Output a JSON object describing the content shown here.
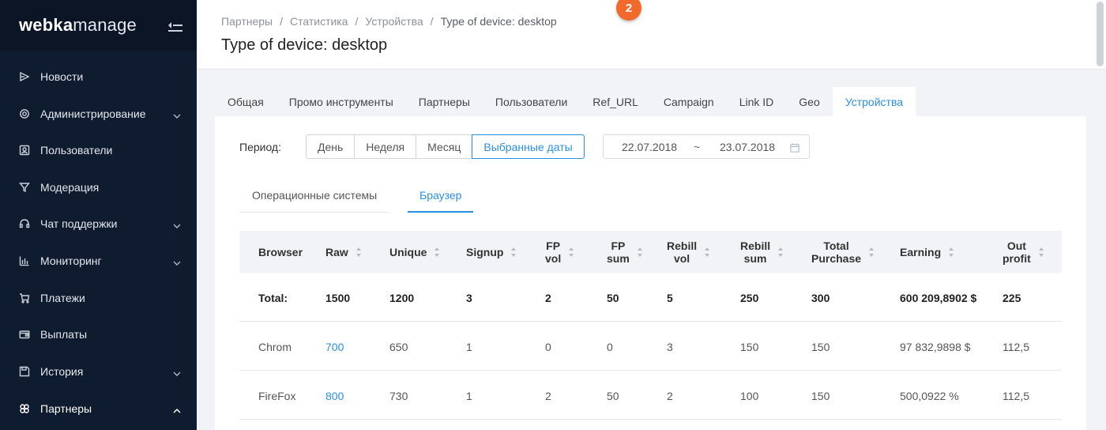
{
  "brand": {
    "logo_bold": "webka",
    "logo_regular": "manage"
  },
  "sidebar": {
    "items": [
      {
        "label": "Новости",
        "icon": "news-icon",
        "has_children": false
      },
      {
        "label": "Администрирование",
        "icon": "gear-icon",
        "has_children": true
      },
      {
        "label": "Пользователи",
        "icon": "users-icon",
        "has_children": false
      },
      {
        "label": "Модерация",
        "icon": "filter-icon",
        "has_children": false
      },
      {
        "label": "Чат поддержки",
        "icon": "headset-icon",
        "has_children": true
      },
      {
        "label": "Мониторинг",
        "icon": "bar-chart-icon",
        "has_children": true
      },
      {
        "label": "Платежи",
        "icon": "cart-icon",
        "has_children": false
      },
      {
        "label": "Выплаты",
        "icon": "wallet-icon",
        "has_children": false
      },
      {
        "label": "История",
        "icon": "save-icon",
        "has_children": true
      },
      {
        "label": "Партнеры",
        "icon": "partners-icon",
        "has_children": true,
        "expanded": true,
        "active": true
      }
    ]
  },
  "header": {
    "breadcrumb": [
      "Партнеры",
      "Статистика",
      "Устройства"
    ],
    "breadcrumb_current": "Type of device: desktop",
    "title": "Type of device: desktop",
    "badge": "2",
    "badge_color": "#f26a2b"
  },
  "tabs": [
    {
      "label": "Общая"
    },
    {
      "label": "Промо инструменты"
    },
    {
      "label": "Партнеры"
    },
    {
      "label": "Пользователи"
    },
    {
      "label": "Ref_URL"
    },
    {
      "label": "Campaign"
    },
    {
      "label": "Link ID"
    },
    {
      "label": "Geo"
    },
    {
      "label": "Устройства",
      "active": true
    }
  ],
  "filters": {
    "period_label": "Период:",
    "period_options": [
      "День",
      "Неделя",
      "Месяц",
      "Выбранные даты"
    ],
    "period_selected": "Выбранные даты",
    "date_from": "22.07.2018",
    "date_separator": "~",
    "date_to": "23.07.2018"
  },
  "subtabs": {
    "os": "Операционные системы",
    "browser": "Браузер",
    "active": "Браузер"
  },
  "table": {
    "columns": [
      {
        "l1": "Browser",
        "l2": ""
      },
      {
        "l1": "Raw",
        "l2": ""
      },
      {
        "l1": "Unique",
        "l2": ""
      },
      {
        "l1": "Signup",
        "l2": ""
      },
      {
        "l1": "FP",
        "l2": "vol"
      },
      {
        "l1": "FP",
        "l2": "sum"
      },
      {
        "l1": "Rebill",
        "l2": "vol"
      },
      {
        "l1": "Rebill",
        "l2": "sum"
      },
      {
        "l1": "Total",
        "l2": "Purchase"
      },
      {
        "l1": "Earning",
        "l2": ""
      },
      {
        "l1": "Out",
        "l2": "profit"
      }
    ],
    "total": [
      "Total:",
      "1500",
      "1200",
      "3",
      "2",
      "50",
      "5",
      "250",
      "300",
      "600 209,8902 $",
      "225"
    ],
    "rows": [
      [
        "Chrom",
        "700",
        "650",
        "1",
        "0",
        "0",
        "3",
        "150",
        "150",
        "97 832,9898 $",
        "112,5"
      ],
      [
        "FireFox",
        "800",
        "730",
        "1",
        "2",
        "50",
        "2",
        "100",
        "150",
        "500,0922 %",
        "112,5"
      ]
    ]
  },
  "colors": {
    "accent": "#2b8fe0",
    "sidebar_bg": "#0f1b2f",
    "logo_bar_bg": "#0b1526",
    "page_bg": "#f2f3f6"
  }
}
